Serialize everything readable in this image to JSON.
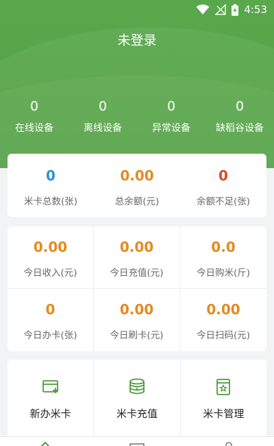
{
  "status_bar": {
    "time": "4:53"
  },
  "header": {
    "title": "未登录"
  },
  "device_stats": [
    {
      "value": "0",
      "label": "在线设备"
    },
    {
      "value": "0",
      "label": "离线设备"
    },
    {
      "value": "0",
      "label": "异常设备"
    },
    {
      "value": "0",
      "label": "缺稻谷设备"
    }
  ],
  "summary": [
    {
      "value": "0",
      "label": "米卡总数(张)"
    },
    {
      "value": "0.00",
      "label": "总余额(元)"
    },
    {
      "value": "0",
      "label": "余额不足(张)"
    }
  ],
  "today_stats": [
    {
      "value": "0.00",
      "label": "今日收入(元)"
    },
    {
      "value": "0.00",
      "label": "今日充值(元)"
    },
    {
      "value": "0.0",
      "label": "今日购米(斤)"
    },
    {
      "value": "0",
      "label": "今日办卡(张)"
    },
    {
      "value": "0.00",
      "label": "今日刷卡(元)"
    },
    {
      "value": "0.00",
      "label": "今日扫码(元)"
    }
  ],
  "actions": [
    {
      "label": "新办米卡",
      "icon": "new-card-icon"
    },
    {
      "label": "米卡充值",
      "icon": "coin-recharge-icon"
    },
    {
      "label": "米卡管理",
      "icon": "card-manage-icon"
    }
  ],
  "colors": {
    "header_green": "#52a346",
    "blue_value": "#2f8fd8",
    "orange_value": "#e58a1f",
    "red_value": "#d9482b",
    "icon_green": "#4a9a3c"
  }
}
